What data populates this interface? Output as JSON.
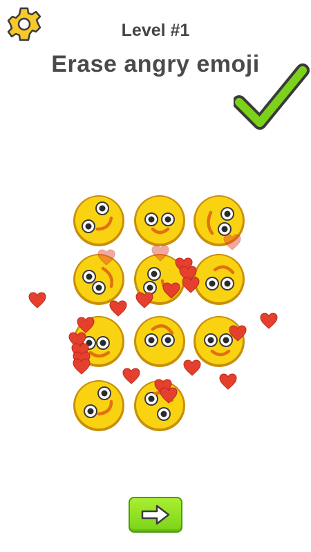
{
  "header": {
    "level_label": "Level #1",
    "instruction": "Erase angry emoji"
  },
  "icons": {
    "settings": "gear-icon",
    "success": "checkmark-icon",
    "next": "arrow-right-icon"
  },
  "colors": {
    "emoji_fill": "#f9d312",
    "emoji_outline": "#c98f0a",
    "mouth": "#e0710f",
    "heart": "#e5402d",
    "check_green": "#7cd21b",
    "button_green": "#8fe122",
    "gear_yellow": "#f7c92a"
  },
  "emoji_grid": {
    "rows": [
      [
        "smiley",
        "smiley",
        "smiley"
      ],
      [
        "smiley",
        "smiley",
        "smiley"
      ],
      [
        "smiley",
        "smiley",
        "smiley"
      ],
      [
        "smiley",
        "smiley"
      ]
    ]
  },
  "heart_particles_count": 24
}
